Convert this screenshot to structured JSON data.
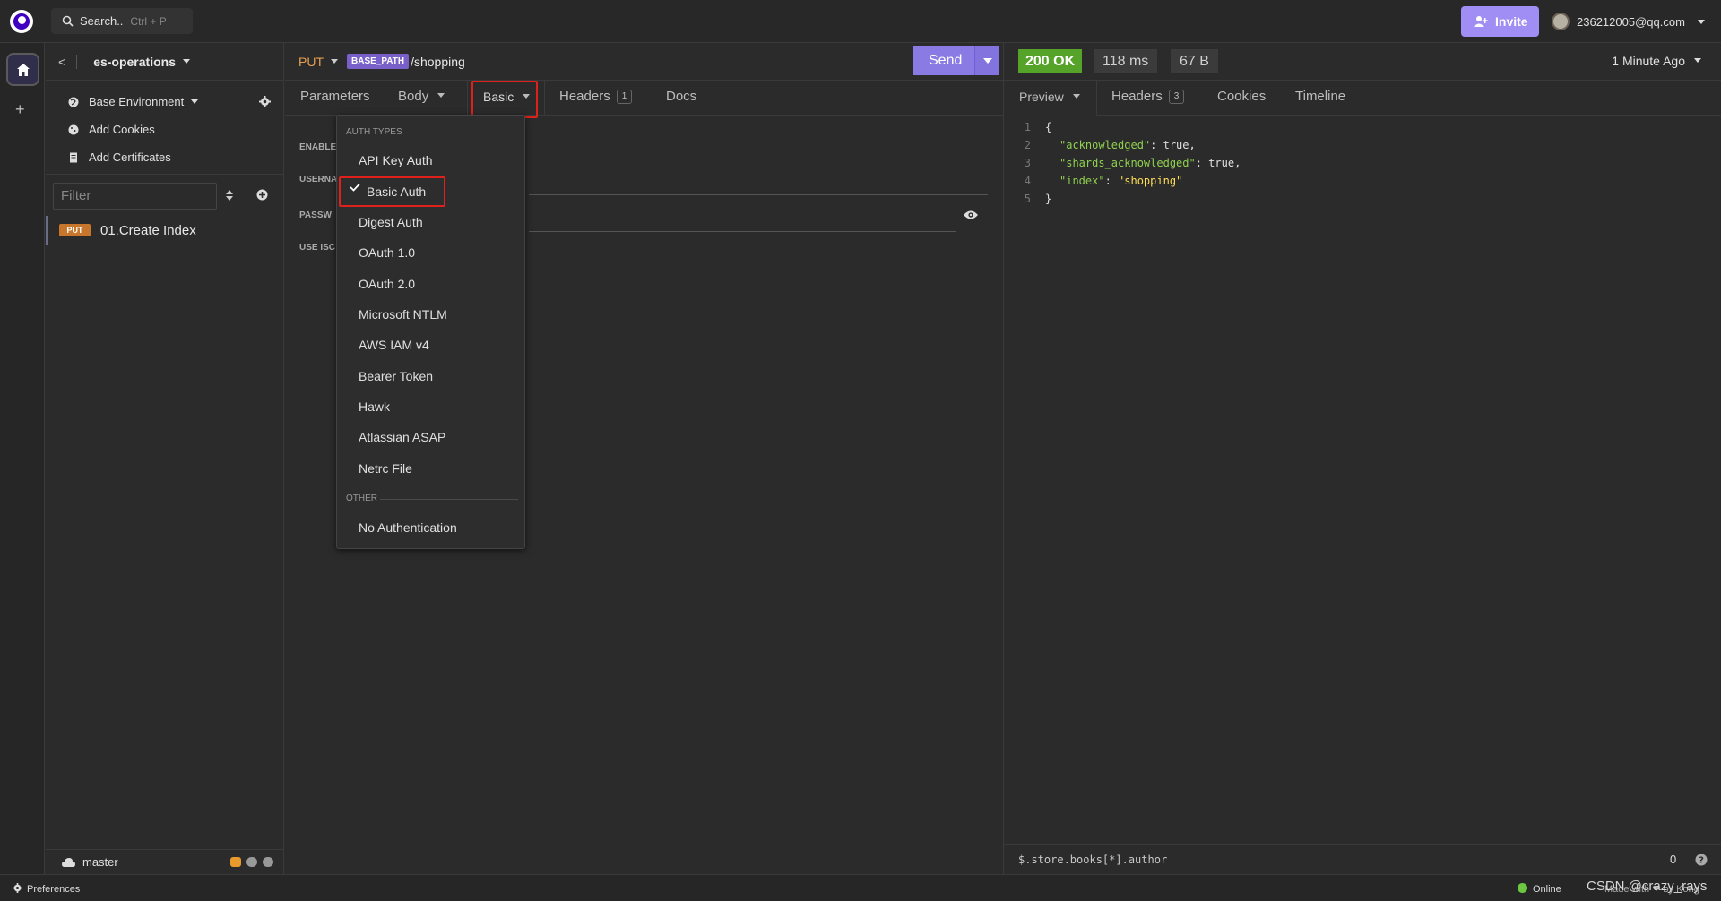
{
  "topbar": {
    "search_label": "Search..",
    "search_shortcut": "Ctrl + P",
    "invite_label": "Invite",
    "user_email": "236212005@qq.com"
  },
  "sidebar": {
    "project_name": "es-operations",
    "environment": "Base Environment",
    "add_cookies": "Add Cookies",
    "add_certificates": "Add Certificates",
    "filter_placeholder": "Filter",
    "requests": [
      {
        "method": "PUT",
        "name": "01.Create Index"
      }
    ],
    "branch": "master"
  },
  "request": {
    "method": "PUT",
    "base_path_tag": "BASE_PATH",
    "path": "/shopping",
    "send_label": "Send",
    "tabs": {
      "parameters": "Parameters",
      "body": "Body",
      "auth": "Basic",
      "headers": "Headers",
      "headers_count": "1",
      "docs": "Docs"
    },
    "form_labels": {
      "enabled": "ENABLE",
      "username": "USERNA",
      "password": "PASSW",
      "use_iso": "USE ISC"
    }
  },
  "auth_dropdown": {
    "auth_types_header": "AUTH TYPES",
    "items": [
      "API Key Auth",
      "Basic Auth",
      "Digest Auth",
      "OAuth 1.0",
      "OAuth 2.0",
      "Microsoft NTLM",
      "AWS IAM v4",
      "Bearer Token",
      "Hawk",
      "Atlassian ASAP",
      "Netrc File"
    ],
    "selected": "Basic Auth",
    "other_header": "OTHER",
    "other_items": [
      "No Authentication"
    ]
  },
  "response": {
    "status": "200 OK",
    "time": "118 ms",
    "size": "67 B",
    "received": "1 Minute Ago",
    "tabs": {
      "preview": "Preview",
      "headers": "Headers",
      "headers_count": "3",
      "cookies": "Cookies",
      "timeline": "Timeline"
    },
    "body_lines": [
      {
        "n": "1",
        "text": "{"
      },
      {
        "n": "2",
        "key": "\"acknowledged\"",
        "sep": ": ",
        "val": "true",
        "end": ","
      },
      {
        "n": "3",
        "key": "\"shards_acknowledged\"",
        "sep": ": ",
        "val": "true",
        "end": ","
      },
      {
        "n": "4",
        "key": "\"index\"",
        "sep": ": ",
        "strval": "\"shopping\"",
        "end": ""
      },
      {
        "n": "5",
        "text": "}"
      }
    ],
    "filter_placeholder": "$.store.books[*].author",
    "filter_count": "0"
  },
  "footer": {
    "preferences": "Preferences",
    "status": "Online",
    "made_with": "Made with ❤ by Kong",
    "watermark": "CSDN @crazy_rays"
  },
  "colors": {
    "accent": "#8a7ae3",
    "status_ok": "#56a32a",
    "method_put": "#c8762b",
    "highlight_box": "#e0201c"
  }
}
